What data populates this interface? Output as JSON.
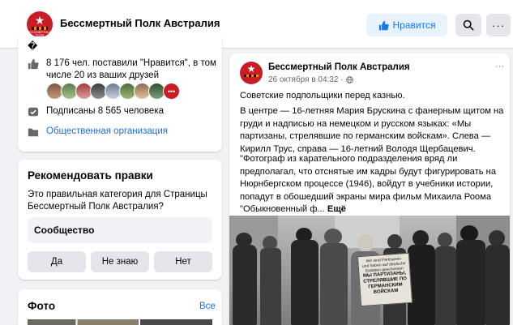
{
  "header": {
    "page_title": "Бессмертный Полк Австралия",
    "like_label": "Нравится",
    "more_label": "···"
  },
  "logo": {
    "star": "★",
    "caption": "БЕССМЕРТНЫЙ ПОЛК"
  },
  "about": {
    "glyph": "�",
    "likes_text": "8 176 чел. поставили \"Нравится\", в том числе 20 из ваших друзей",
    "friends_more": "•••",
    "subscribers_text": "Подписаны 8 565 человека",
    "category_link": "Общественная организация"
  },
  "suggest": {
    "title": "Рекомендовать правки",
    "question": "Это правильная категория для Страницы Бессмертный Полк Австралия?",
    "value": "Сообщество",
    "answers": [
      "Да",
      "Не знаю",
      "Нет"
    ]
  },
  "photos": {
    "title": "Фото",
    "see_all": "Все"
  },
  "post": {
    "author": "Бессмертный Полк Австралия",
    "date": "26 октября в 04:32 ·",
    "more": "···",
    "p1": "Советские подпольщики перед казнью.",
    "p2": "В центре — 16-летняя Мария Брускина с фанерным щитом на груди и надписью на немецком и русском языках: «Мы партизаны, стрелявшие по германским войскам». Слева — Кирилл Трус, справа — 16-летний Володя Щербацевич.",
    "p3": "\"Фотограф из карательного подразделения вряд ли предполагал, что отснятые им кадры будут фигурировать на Нюрнбергском процессе (1946), войдут в учебники истории, попадут в обошедший экраны мира фильм Михаила Роома \"Обыкновенный ф... ",
    "see_more": "Ещё",
    "sign_lines": [
      "Wir sind Partisanen",
      "und haben auf deutsche",
      "Soldaten geschossen",
      "МЫ ПАРТИЗАНЫ,",
      "СТРЕЛЯВШИЕ ПО",
      "ГЕРМАНСКИМ",
      "ВОЙСКАМ"
    ]
  },
  "colors": {
    "brand_red": "#c81d25",
    "facebook_blue": "#1877f2",
    "link_blue": "#216fdb",
    "background": "#f0f2f5"
  }
}
